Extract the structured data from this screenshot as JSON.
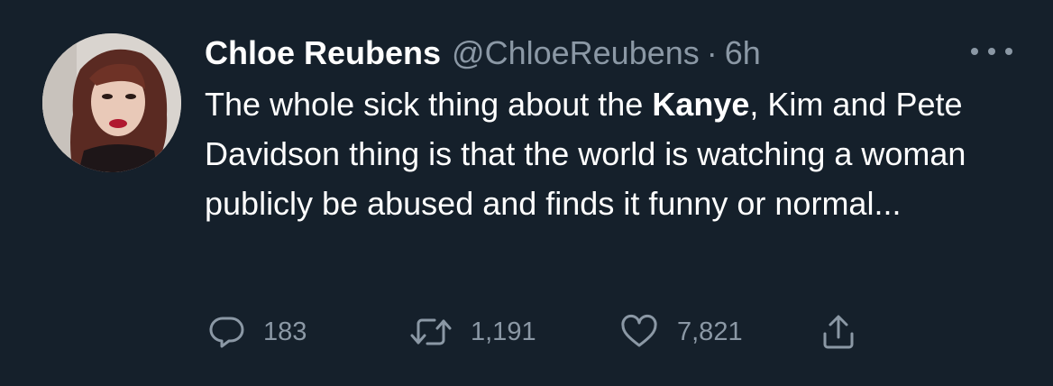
{
  "tweet": {
    "author_name": "Chloe Reubens",
    "handle": "@ChloeReubens",
    "separator": "·",
    "time": "6h",
    "text_part1": "The whole sick thing about the ",
    "text_bold": "Kanye",
    "text_part2": ", Kim and Pete Davidson thing is that the world is watching a woman publicly be abused and finds it funny or normal..."
  },
  "actions": {
    "replies": "183",
    "retweets": "1,191",
    "likes": "7,821"
  },
  "icons": {
    "reply": "reply-icon",
    "retweet": "retweet-icon",
    "like": "heart-icon",
    "share": "share-icon",
    "more": "more-icon"
  },
  "colors": {
    "background": "#15202b",
    "text_primary": "#ffffff",
    "text_secondary": "#8b98a5"
  }
}
